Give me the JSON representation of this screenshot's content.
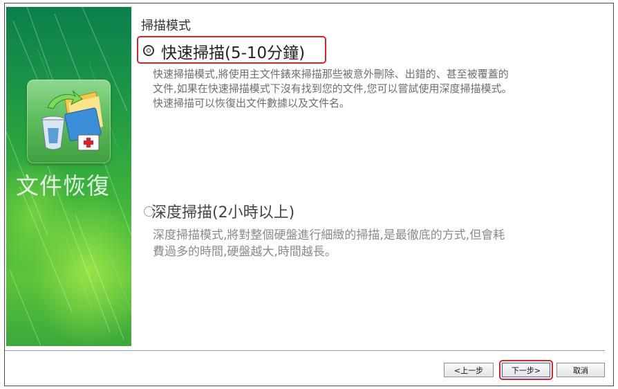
{
  "side_panel": {
    "title": "文件恢復",
    "icon": "recycle-bin-folder-recovery-icon"
  },
  "heading": "掃描模式",
  "options": [
    {
      "label": "快速掃描(5-10分鐘)",
      "selected": true,
      "description": [
        "快速掃描模式,將使用主文件錶來掃描那些被意外刪除、出錯的、甚至被覆蓋的",
        "文件,如果在快速掃描模式下沒有找到您的文件,您可以嘗試使用深度掃描模式。",
        "快速掃描可以恢復出文件數據以及文件名。"
      ]
    },
    {
      "label": "深度掃描(2小時以上)",
      "selected": false,
      "description": [
        "深度掃描模式,將對整個硬盤進行細緻的掃描,是最徹底的方式,但會耗",
        "費過多的時間,硬盤越大,時間越長。"
      ]
    }
  ],
  "buttons": {
    "back": "<上一步",
    "next": "下一步>",
    "cancel": "取消"
  },
  "colors": {
    "highlight_box": "#d8232a",
    "panel_green_top": "#0b7f4c",
    "panel_green_bottom": "#5cc33a"
  }
}
